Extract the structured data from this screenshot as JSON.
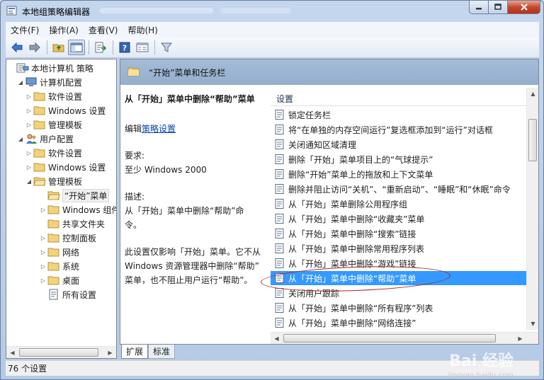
{
  "window": {
    "title": "本地组策略编辑器",
    "min_icon": "minimize-icon",
    "max_icon": "maximize-icon",
    "close_icon": "close-icon"
  },
  "menu": [
    "文件(F)",
    "操作(A)",
    "查看(V)",
    "帮助(H)"
  ],
  "toolbar": {
    "icons": [
      "back-arrow-icon",
      "forward-arrow-icon",
      "up-folder-icon",
      "show-hide-tree-icon",
      "export-list-icon",
      "help-icon",
      "properties-icon",
      "filter-icon"
    ]
  },
  "tree": {
    "items": [
      {
        "label": "本地计算机 策略",
        "icon": "computer-policy-icon",
        "expander": ""
      },
      {
        "label": "计算机配置",
        "icon": "computer-icon",
        "expander": "◢"
      },
      {
        "label": "软件设置",
        "icon": "folder-icon",
        "expander": "▷"
      },
      {
        "label": "Windows 设置",
        "icon": "folder-icon",
        "expander": "▷"
      },
      {
        "label": "管理模板",
        "icon": "folder-icon",
        "expander": "▷"
      },
      {
        "label": "用户配置",
        "icon": "user-icon",
        "expander": "◢"
      },
      {
        "label": "软件设置",
        "icon": "folder-icon",
        "expander": "▷"
      },
      {
        "label": "Windows 设置",
        "icon": "folder-icon",
        "expander": "▷"
      },
      {
        "label": "管理模板",
        "icon": "folder-open-icon",
        "expander": "◢"
      },
      {
        "label": "“开始”菜单",
        "icon": "folder-open-icon",
        "expander": ""
      },
      {
        "label": "Windows 组件",
        "icon": "folder-icon",
        "expander": "▷"
      },
      {
        "label": "共享文件夹",
        "icon": "folder-icon",
        "expander": ""
      },
      {
        "label": "控制面板",
        "icon": "folder-icon",
        "expander": "▷"
      },
      {
        "label": "网络",
        "icon": "folder-icon",
        "expander": "▷"
      },
      {
        "label": "系统",
        "icon": "folder-icon",
        "expander": "▷"
      },
      {
        "label": "桌面",
        "icon": "folder-icon",
        "expander": "▷"
      },
      {
        "label": "所有设置",
        "icon": "all-settings-icon",
        "expander": ""
      }
    ]
  },
  "right": {
    "header_title": "“开始”菜单和任务栏",
    "desc": {
      "title": "从「开始」菜单中删除“帮助”菜单",
      "edit_prefix": "编辑",
      "edit_link": "策略设置",
      "req_label": "要求:",
      "req_value": "至少 Windows 2000",
      "desc_label": "描述:",
      "desc_lines": [
        "从「开始」菜单中删除“帮助”命",
        "令。"
      ],
      "note_lines": [
        "此设置仅影响「开始」菜单。它不从",
        "Windows 资源管理器中删除“帮助”",
        "菜单，也不阻止用户运行“帮助”。"
      ]
    },
    "column_header": "设置",
    "settings": [
      "锁定任务栏",
      "将“在单独的内存空间运行”复选框添加到“运行”对话框",
      "关闭通知区域清理",
      "删除「开始」菜单项目上的“气球提示”",
      "删除“开始”菜单上的拖放和上下文菜单",
      "删除并阻止访问“关机”、“重新启动”、“睡眠”和“休眠”命令",
      "从「开始」菜单删除公用程序组",
      "从「开始」菜单中删除“收藏夹”菜单",
      "从「开始」菜单中删除“搜索”链接",
      "从「开始」菜单中删除常用程序列表",
      "从「开始」菜单中删除“游戏”链接",
      "从「开始」菜单中删除“帮助”菜单",
      "关闭用户跟踪",
      "从「开始」菜单中删除“所有程序”列表",
      "从「开始」菜单中删除“网络连接”"
    ],
    "selected_index": 11
  },
  "tabs": [
    "扩展",
    "标准"
  ],
  "status": "76 个设置",
  "watermark": {
    "text": "Bai 经验",
    "sub": "jingyan.baidu.com"
  },
  "colors": {
    "selection": "#3399ff",
    "annotation": "#b2202a",
    "header": "#a5bcd7"
  }
}
